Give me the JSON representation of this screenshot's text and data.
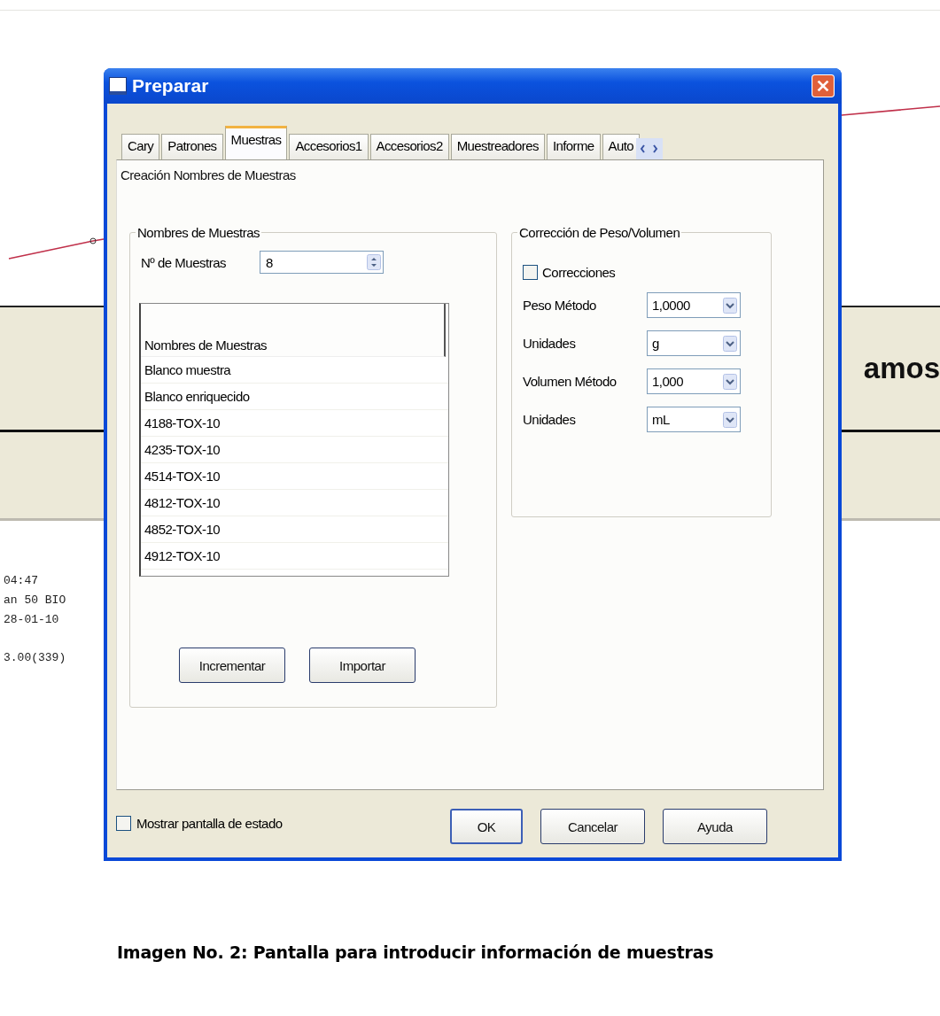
{
  "background_app": {
    "band_text": "amos",
    "log_lines": [
      "04:47",
      "an 50 BIO",
      "28-01-10",
      "3.00(339)"
    ]
  },
  "window": {
    "title": "Preparar"
  },
  "tabs": [
    {
      "label": "Cary",
      "selected": false
    },
    {
      "label": "Patrones",
      "selected": false
    },
    {
      "label": "Muestras",
      "selected": true
    },
    {
      "label": "Accesorios1",
      "selected": false
    },
    {
      "label": "Accesorios2",
      "selected": false
    },
    {
      "label": "Muestreadores",
      "selected": false
    },
    {
      "label": "Informe",
      "selected": false
    },
    {
      "label": "Auto",
      "selected": false
    }
  ],
  "page_heading": "Creación Nombres de Muestras",
  "sample_names": {
    "group_title": "Nombres de Muestras",
    "count_label": "Nº de Muestras",
    "count_value": "8",
    "table": {
      "column": "Nombres de Muestras",
      "rows": [
        "Blanco muestra",
        "Blanco enriquecido",
        "4188-TOX-10",
        "4235-TOX-10",
        "4514-TOX-10",
        "4812-TOX-10",
        "4852-TOX-10",
        "4912-TOX-10"
      ]
    },
    "buttons": [
      "Incrementar",
      "Importar"
    ]
  },
  "correction": {
    "group_title": "Corrección de Peso/Volumen",
    "checkbox": {
      "label": "Correcciones",
      "checked": false
    },
    "fields": [
      {
        "label": "Peso Método",
        "value": "1,0000"
      },
      {
        "label": "Unidades",
        "value": "g"
      },
      {
        "label": "Volumen Método",
        "value": "1,000"
      },
      {
        "label": "Unidades",
        "value": "mL"
      }
    ]
  },
  "status_checkbox": {
    "label": "Mostrar pantalla de estado",
    "checked": false
  },
  "dialog_buttons": [
    {
      "label": "OK",
      "default": true
    },
    {
      "label": "Cancelar",
      "default": false
    },
    {
      "label": "Ayuda",
      "default": false
    }
  ],
  "caption": "Imagen No. 2: Pantalla para introducir información de muestras"
}
